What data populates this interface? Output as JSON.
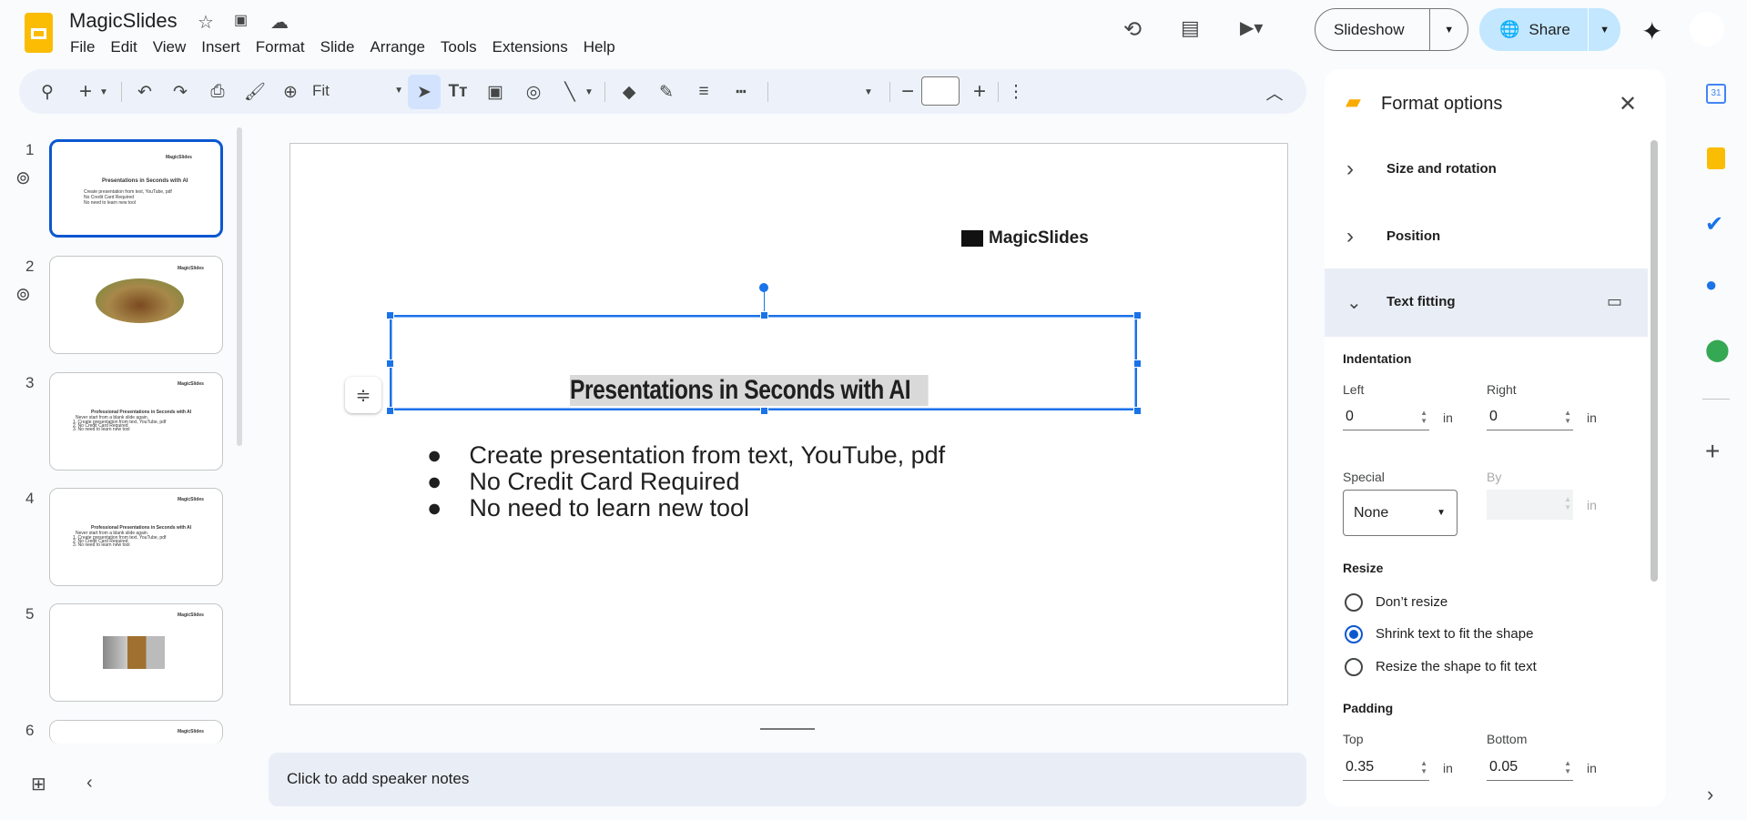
{
  "app": {
    "title": "MagicSlides",
    "menu": [
      "File",
      "Edit",
      "View",
      "Insert",
      "Format",
      "Slide",
      "Arrange",
      "Tools",
      "Extensions",
      "Help"
    ]
  },
  "header": {
    "slideshow_label": "Slideshow",
    "share_label": "Share"
  },
  "toolbar": {
    "zoom_value": "Fit",
    "font_size": ""
  },
  "slides": [
    {
      "number": "1",
      "title": "Presentations in Seconds with AI",
      "bullets": [
        "Create presentation from text, YouTube, pdf",
        "No Credit Card Required",
        "No need to learn new tool"
      ],
      "logo": "MagicSlides"
    },
    {
      "number": "2",
      "logo": "MagicSlides"
    },
    {
      "number": "3",
      "title": "Professional Presentations in Seconds with AI",
      "subtitle": "Never start from a blank slide again.",
      "items": [
        "1. Create presentation from text, YouTube, pdf",
        "2. No Credit Card Required",
        "3. No need to learn new tool"
      ],
      "logo": "MagicSlides"
    },
    {
      "number": "4",
      "title": "Professional Presentations in Seconds with AI",
      "subtitle": "Never start from a blank slide again.",
      "items": [
        "1. Create presentation from text, YouTube, pdf",
        "2. No Credit Card Required",
        "3. No need to learn new tool"
      ],
      "logo": "MagicSlides"
    },
    {
      "number": "5",
      "logo": "MagicSlides"
    },
    {
      "number": "6",
      "logo": "MagicSlides"
    }
  ],
  "canvas": {
    "logo": "MagicSlides",
    "title": "Presentations in Seconds with AI",
    "bullets": [
      "Create presentation from text, YouTube, pdf",
      "No Credit Card Required",
      "No need to learn new tool"
    ]
  },
  "notes": {
    "placeholder": "Click to add speaker notes"
  },
  "format": {
    "title": "Format options",
    "sections": [
      "Size and rotation",
      "Position",
      "Text fitting"
    ],
    "indentation": "Indentation",
    "left_label": "Left",
    "left_value": "0",
    "right_label": "Right",
    "right_value": "0",
    "unit": "in",
    "special_label": "Special",
    "special_value": "None",
    "by_label": "By",
    "resize": "Resize",
    "resize_options": [
      "Don’t resize",
      "Shrink text to fit the shape",
      "Resize the shape to fit text"
    ],
    "resize_selected": 1,
    "padding": "Padding",
    "top_label": "Top",
    "top_value": "0.35",
    "bottom_label": "Bottom",
    "bottom_value": "0.05"
  },
  "colors": {
    "accent": "#0b57d0",
    "share_bg": "#c2e7ff",
    "selection": "#1a73e8"
  }
}
